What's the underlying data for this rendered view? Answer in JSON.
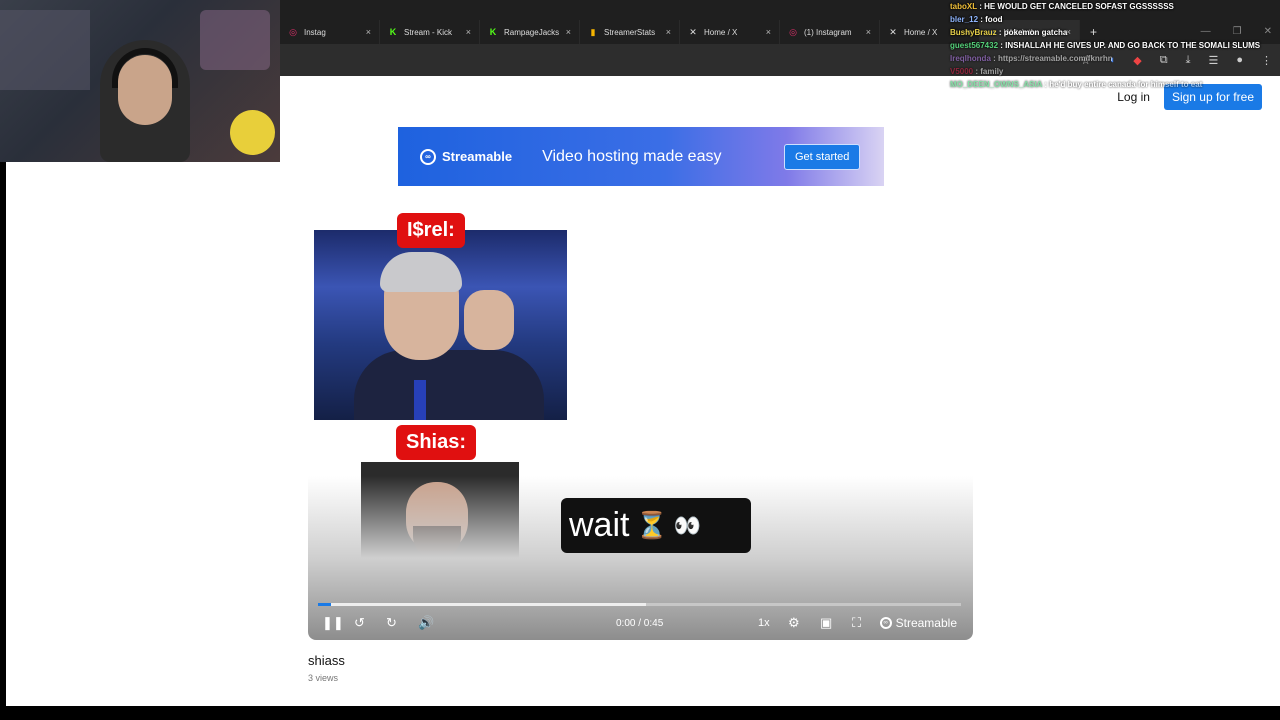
{
  "browser": {
    "tabs": [
      {
        "icon": "instagram-icon",
        "label": "Instag",
        "close": "×"
      },
      {
        "icon": "kick-icon",
        "label": "Stream - Kick",
        "close": "×"
      },
      {
        "icon": "kick-icon",
        "label": "RampageJacks",
        "close": "×"
      },
      {
        "icon": "bar-chart-icon",
        "label": "StreamerStats",
        "close": "×"
      },
      {
        "icon": "x-logo-icon",
        "label": "Home / X",
        "close": "×"
      },
      {
        "icon": "instagram-icon",
        "label": "(1) Instagram",
        "close": "×"
      },
      {
        "icon": "x-logo-icon",
        "label": "Home / X",
        "close": "×"
      },
      {
        "icon": "streamable-icon",
        "label": "Watch th",
        "close": "×"
      }
    ],
    "new_tab": "+"
  },
  "header": {
    "login": "Log in",
    "signup": "Sign up for free"
  },
  "banner": {
    "logo": "Streamable",
    "tagline": "Video hosting made easy",
    "cta": "Get started"
  },
  "video": {
    "label1": "I$rel:",
    "label2": "Shias:",
    "wait_text": "wait",
    "hourglass": "⏳",
    "eyes": "👀",
    "time": "0:00 / 0:45",
    "speed": "1x",
    "brand": "Streamable",
    "progress_played": 0.02,
    "progress_buffered": 0.51,
    "title": "shiass",
    "views": "3 views"
  },
  "chat": [
    {
      "user": "taboXL",
      "user_color": "#f2c13a",
      "msg": ": HE WOULD GET CANCELED SOFAST GGSSSSSS",
      "dim": false
    },
    {
      "user": "bler_12",
      "user_color": "#8fb6ff",
      "msg": ": food",
      "dim": false
    },
    {
      "user": "BushyBrauz",
      "user_color": "#e7d04a",
      "msg": ": pokemon gatcha",
      "dim": false
    },
    {
      "user": "guest567432",
      "user_color": "#55d17a",
      "msg": ": INSHALLAH HE GIVES UP. AND GO BACK TO THE SOMALI SLUMS",
      "dim": false
    },
    {
      "user": "Ireqlhonda",
      "user_color": "#c084fc",
      "msg": ": https://streamable.com/fknrhn",
      "dim": true
    },
    {
      "user": "V5000",
      "user_color": "#e11d48",
      "msg": ": family",
      "dim": true
    },
    {
      "user": "MO_DEEN_OWNS_ASIA",
      "user_color": "#22c55e",
      "msg": ": he'd buy entire canada for himself to eat",
      "dim": true
    }
  ]
}
